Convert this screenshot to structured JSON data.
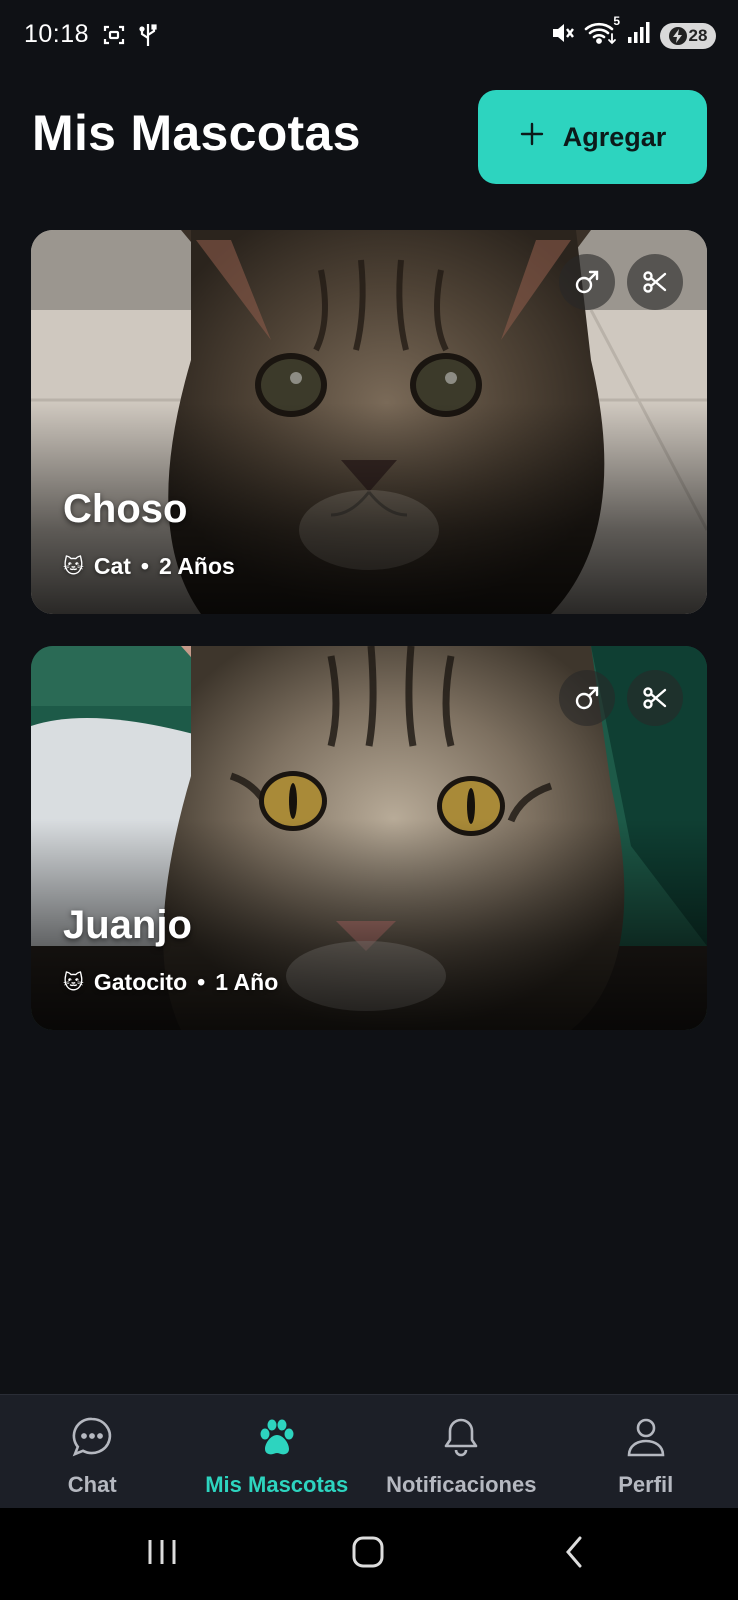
{
  "status_bar": {
    "time": "10:18",
    "battery": "28",
    "wifi_badge": "5"
  },
  "header": {
    "title": "Mis Mascotas",
    "add_label": "Agregar"
  },
  "pets": [
    {
      "name": "Choso",
      "species_emoji": "🐱",
      "species": "Cat",
      "separator": "•",
      "age": "2 Años",
      "badges": [
        "male-icon",
        "scissors-icon"
      ]
    },
    {
      "name": "Juanjo",
      "species_emoji": "🐱",
      "species": "Gatocito",
      "separator": "•",
      "age": "1 Año",
      "badges": [
        "male-icon",
        "scissors-icon"
      ]
    }
  ],
  "bottom_nav": {
    "items": [
      {
        "label": "Chat",
        "icon": "chat-bubble-icon"
      },
      {
        "label": "Mis Mascotas",
        "icon": "paw-icon",
        "active": true
      },
      {
        "label": "Notificaciones",
        "icon": "bell-icon"
      },
      {
        "label": "Perfil",
        "icon": "person-icon"
      }
    ]
  },
  "colors": {
    "accent": "#2dd4bf",
    "background": "#0f1115",
    "nav_background": "#1c1f27"
  }
}
